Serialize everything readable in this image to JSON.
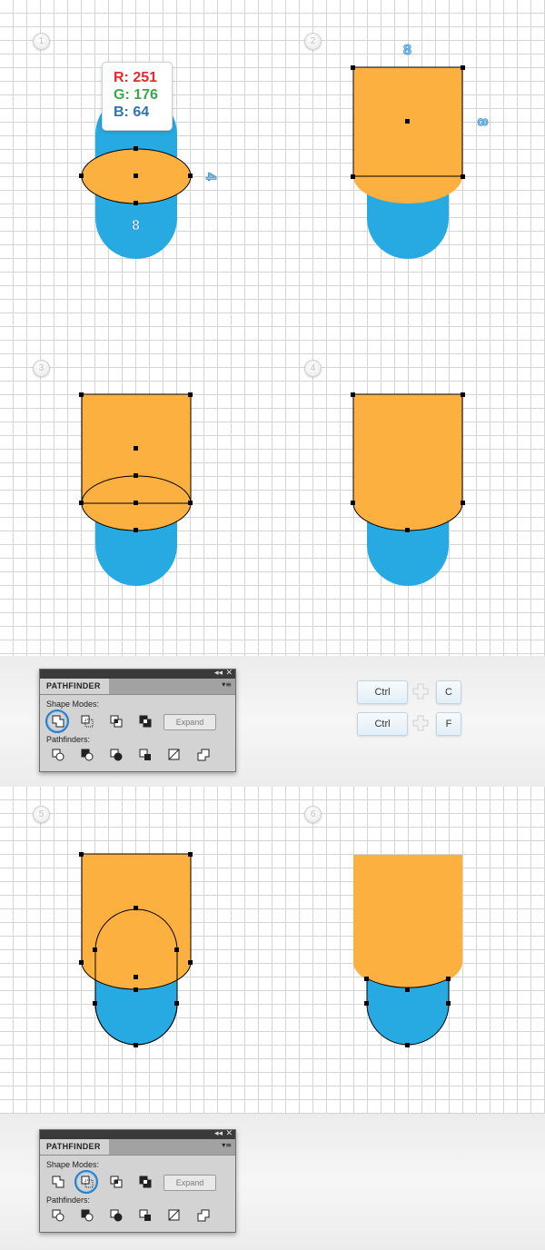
{
  "colors": {
    "orange": "#FBB040",
    "blue": "#27AAE1",
    "grid": "#d4d4d4",
    "strip": "#efefef"
  },
  "steps": [
    "1",
    "2",
    "3",
    "4",
    "5",
    "6"
  ],
  "rgb_callout": {
    "r": "R: 251",
    "g": "G: 176",
    "b": "B: 64"
  },
  "dimensions": {
    "step1_bottom": "8",
    "step1_right": "4",
    "step2_top": "8",
    "step2_right": "8"
  },
  "pathfinder": {
    "title": "PATHFINDER",
    "shape_modes_label": "Shape Modes:",
    "pathfinders_label": "Pathfinders:",
    "expand_label": "Expand",
    "collapse_icon": "double-left-arrow-icon",
    "close_icon": "close-icon",
    "menu_icon": "panel-menu-icon"
  },
  "shortcuts": [
    {
      "mod": "Ctrl",
      "plus": "+",
      "key": "C"
    },
    {
      "mod": "Ctrl",
      "plus": "+",
      "key": "F"
    }
  ]
}
